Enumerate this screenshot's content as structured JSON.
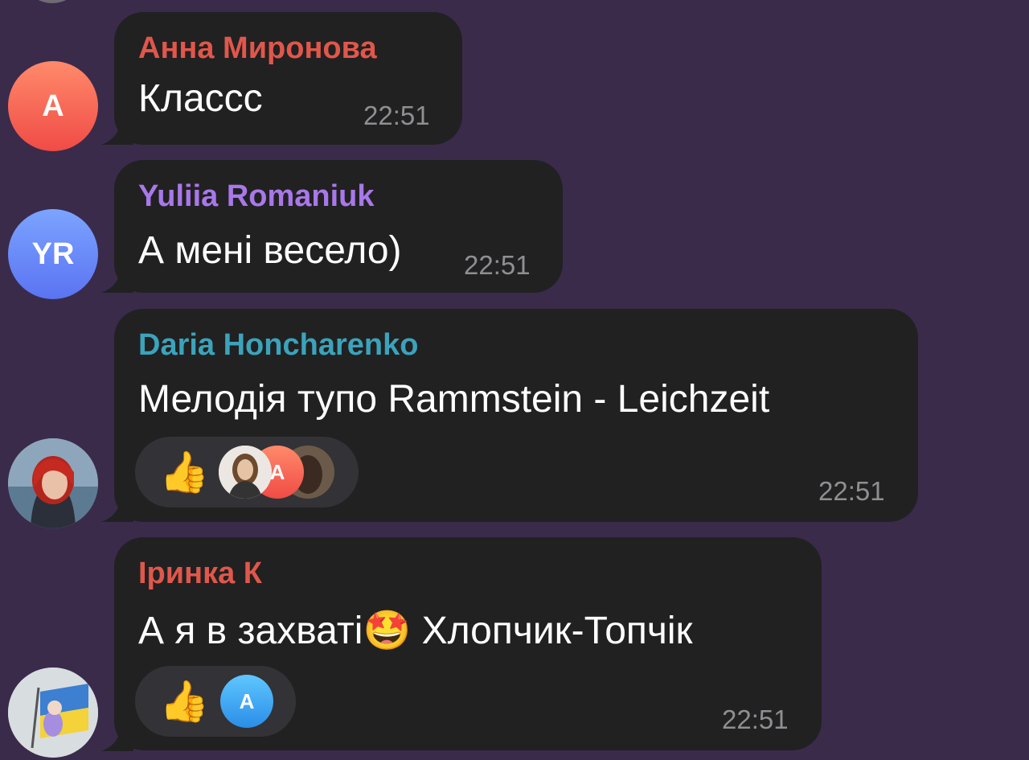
{
  "messages": [
    {
      "sender": "Анна Миронова",
      "sender_color": "#e0574b",
      "avatar_initials": "А",
      "text": "Классс",
      "time": "22:51"
    },
    {
      "sender": "Yuliia Romaniuk",
      "sender_color": "#a878ea",
      "avatar_initials": "YR",
      "text": "А мені весело)",
      "time": "22:51"
    },
    {
      "sender": "Daria Honcharenko",
      "sender_color": "#3ba3bb",
      "avatar_type": "photo",
      "text": "Мелодія тупо  Rammstein - Leichzeit",
      "time": "22:51",
      "reaction_emoji": "👍",
      "reaction_avatars": [
        "photo",
        "А",
        "photo"
      ]
    },
    {
      "sender": "Іринка К",
      "sender_color": "#e0574b",
      "avatar_type": "photo",
      "text": "А я в захваті🤩 Хлопчик-Топчік",
      "time": "22:51",
      "reaction_emoji": "👍",
      "reaction_avatars": [
        "А"
      ]
    }
  ],
  "colors": {
    "background": "#3a2b4b",
    "bubble": "#212121",
    "timestamp": "#8f8f93"
  }
}
